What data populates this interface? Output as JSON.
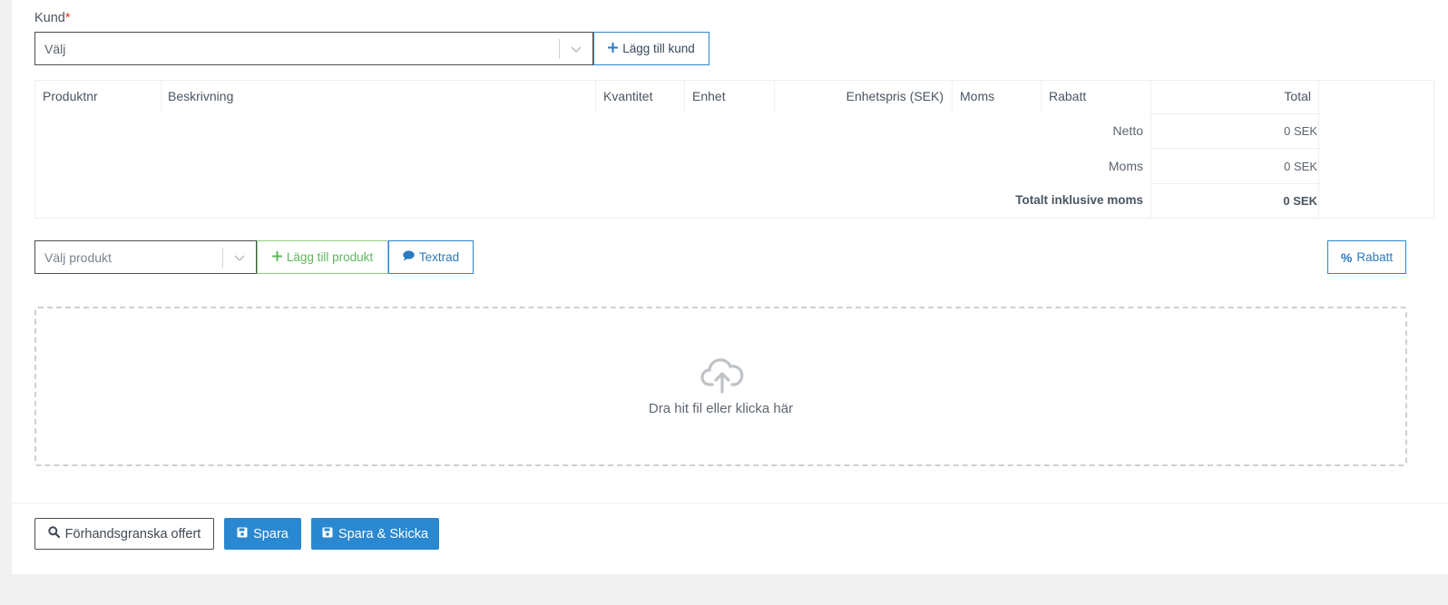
{
  "customer": {
    "label": "Kund",
    "required_mark": "*",
    "select_value": "Välj",
    "add_button_label": "Lägg till kund"
  },
  "table": {
    "headers": [
      "Produktnr",
      "Beskrivning",
      "Kvantitet",
      "Enhet",
      "Enhetspris (SEK)",
      "Moms",
      "Rabatt",
      "Total"
    ],
    "summary": [
      {
        "label": "Netto",
        "value": "0 SEK"
      },
      {
        "label": "Moms",
        "value": "0 SEK"
      },
      {
        "label": "Totalt inklusive moms",
        "value": "0 SEK"
      }
    ]
  },
  "product_bar": {
    "select_placeholder": "Välj produkt",
    "add_product_label": "Lägg till produkt",
    "text_row_label": "Textrad",
    "discount_label": "Rabatt"
  },
  "dropzone": {
    "text": "Dra hit fil eller klicka här"
  },
  "footer": {
    "preview_label": "Förhandsgranska offert",
    "save_label": "Spara",
    "save_send_label": "Spara & Skicka"
  },
  "colors": {
    "primary": "#2a88d0",
    "success": "#5cb85c",
    "required": "#e3342f"
  }
}
